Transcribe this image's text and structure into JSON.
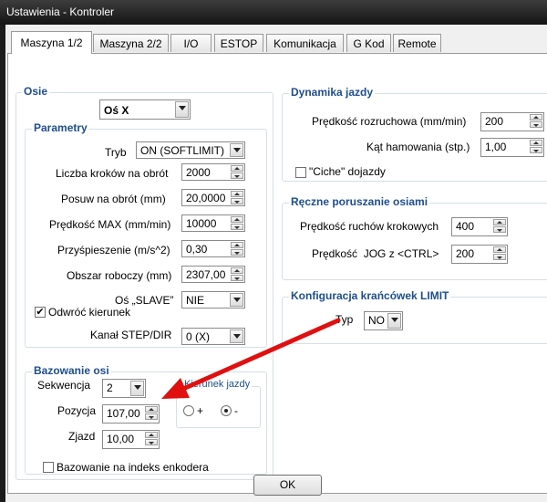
{
  "window": {
    "title": "Ustawienia - Kontroler"
  },
  "tabs": [
    "Maszyna 1/2",
    "Maszyna 2/2",
    "I/O",
    "ESTOP",
    "Komunikacja",
    "G Kod",
    "Remote"
  ],
  "osie": {
    "title": "Osie",
    "axis_select": "Oś X",
    "parametry": {
      "title": "Parametry",
      "tryb_label": "Tryb",
      "tryb_value": "ON (SOFTLIMIT)",
      "kroki_label": "Liczba kroków na obrót",
      "kroki_value": "2000",
      "posuw_label": "Posuw na obrót (mm)",
      "posuw_value": "20,0000",
      "predkosc_label": "Prędkość MAX (mm/min)",
      "predkosc_value": "10000",
      "przysp_label": "Przyśpieszenie (m/s^2)",
      "przysp_value": "0,30",
      "obszar_label": "Obszar roboczy (mm)",
      "obszar_value": "2307,00",
      "slave_label": "Oś „SLAVE”",
      "slave_value": "NIE",
      "odwroc_label": "Odwróć kierunek",
      "odwroc_checked": true,
      "kanal_label": "Kanał STEP/DIR",
      "kanal_value": "0 (X)"
    },
    "bazowanie": {
      "title": "Bazowanie osi",
      "sekwencja_label": "Sekwencja",
      "sekwencja_value": "2",
      "pozycja_label": "Pozycja",
      "pozycja_value": "107,00",
      "zjazd_label": "Zjazd",
      "zjazd_value": "10,00",
      "kierunek_title": "Kierunek jazdy",
      "plus_label": "+",
      "minus_label": "-",
      "selected_direction": "-",
      "indeks_label": "Bazowanie na indeks enkodera",
      "indeks_checked": false
    }
  },
  "dynamika": {
    "title": "Dynamika jazdy",
    "rozruch_label": "Prędkość rozruchowa (mm/min)",
    "rozruch_value": "200",
    "hamowanie_label": "Kąt hamowania (stp.)",
    "hamowanie_value": "1,00",
    "ciche_label": "\"Ciche\" dojazdy",
    "ciche_checked": false
  },
  "reczne": {
    "title": "Ręczne poruszanie osiami",
    "krokowe_label": "Prędkość ruchów krokowych",
    "krokowe_value": "400",
    "jog_label": "Prędkość  JOG z <CTRL>",
    "jog_value": "200"
  },
  "krancowki": {
    "title": "Konfiguracja krańcówek LIMIT",
    "typ_label": "Typ",
    "typ_value": "NO"
  },
  "ok_label": "OK",
  "colors": {
    "group_title": "#1e4e8c",
    "arrow": "#e01010",
    "titlebar": "#1a1a1a"
  }
}
